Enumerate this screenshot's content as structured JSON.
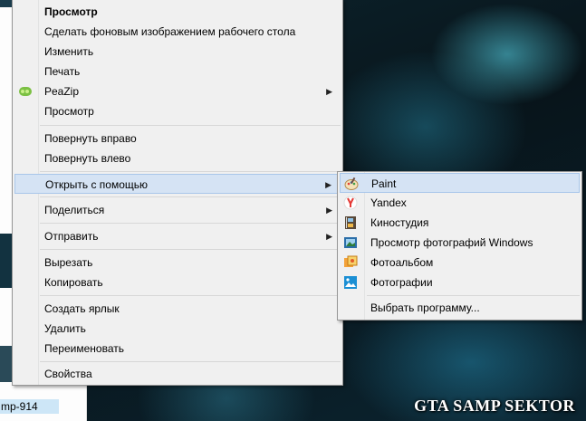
{
  "background": {
    "explorer_partial_label": "mp-914",
    "watermark": "GTA SAMP SEKTOR"
  },
  "context_menu": {
    "items": [
      {
        "label": "Просмотр",
        "bold": true
      },
      {
        "label": "Сделать фоновым изображением рабочего стола"
      },
      {
        "label": "Изменить"
      },
      {
        "label": "Печать"
      },
      {
        "label": "PeaZip",
        "icon": "peazip-icon",
        "submenu": true
      },
      {
        "label": "Просмотр"
      },
      {
        "label": "Повернуть вправо"
      },
      {
        "label": "Повернуть влево"
      },
      {
        "label": "Открыть с помощью",
        "submenu": true,
        "highlighted": true
      },
      {
        "label": "Поделиться",
        "submenu": true
      },
      {
        "label": "Отправить",
        "submenu": true
      },
      {
        "label": "Вырезать"
      },
      {
        "label": "Копировать"
      },
      {
        "label": "Создать ярлык"
      },
      {
        "label": "Удалить"
      },
      {
        "label": "Переименовать"
      },
      {
        "label": "Свойства"
      }
    ],
    "submenu_arrow": "▶"
  },
  "open_with_menu": {
    "items": [
      {
        "label": "Paint",
        "icon": "paint-icon",
        "highlighted": true
      },
      {
        "label": "Yandex",
        "icon": "yandex-icon"
      },
      {
        "label": "Киностудия",
        "icon": "movie-maker-icon"
      },
      {
        "label": "Просмотр фотографий Windows",
        "icon": "photo-viewer-icon"
      },
      {
        "label": "Фотоальбом",
        "icon": "photo-gallery-icon"
      },
      {
        "label": "Фотографии",
        "icon": "photos-app-icon"
      },
      {
        "label": "Выбрать программу..."
      }
    ]
  },
  "colors": {
    "menu_bg": "#f0f0f0",
    "hover_bg": "#d5e3f4",
    "hover_border": "#a8c6ea"
  }
}
